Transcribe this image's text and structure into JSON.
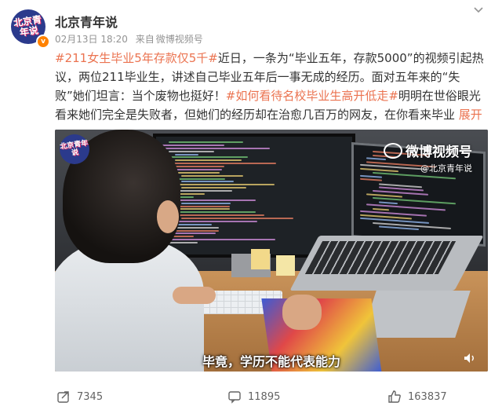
{
  "account": {
    "name": "北京青年说",
    "avatar_text": "北京青年说",
    "date": "02月13日 18:20",
    "source_prefix": "来自",
    "source": "微博视频号"
  },
  "post": {
    "tag1": "#211女生毕业5年存款仅5千#",
    "text1": "近日，一条为“毕业五年，存款5000”的视频引起热议，两位211毕业生，讲述自己毕业五年后一事无成的经历。面对五年来的“失败”她们坦言：当个废物也挺好！",
    "tag2": "#如何看待名校毕业生高开低走#",
    "text2": "明明在世俗眼光看来她们完全是失败者，但她们的经历却在治愈几百万的网友，在你看来毕业",
    "expand": "展开"
  },
  "video": {
    "logo_text": "北京青年说",
    "watermark_main": "微博视频号",
    "watermark_sub": "@北京青年说",
    "subtitle": "毕竟，学历不能代表能力"
  },
  "actions": {
    "reposts": "7345",
    "comments": "11895",
    "likes": "163837"
  },
  "colors": {
    "link": "#eb7350",
    "brand_badge": "#ff8200"
  }
}
